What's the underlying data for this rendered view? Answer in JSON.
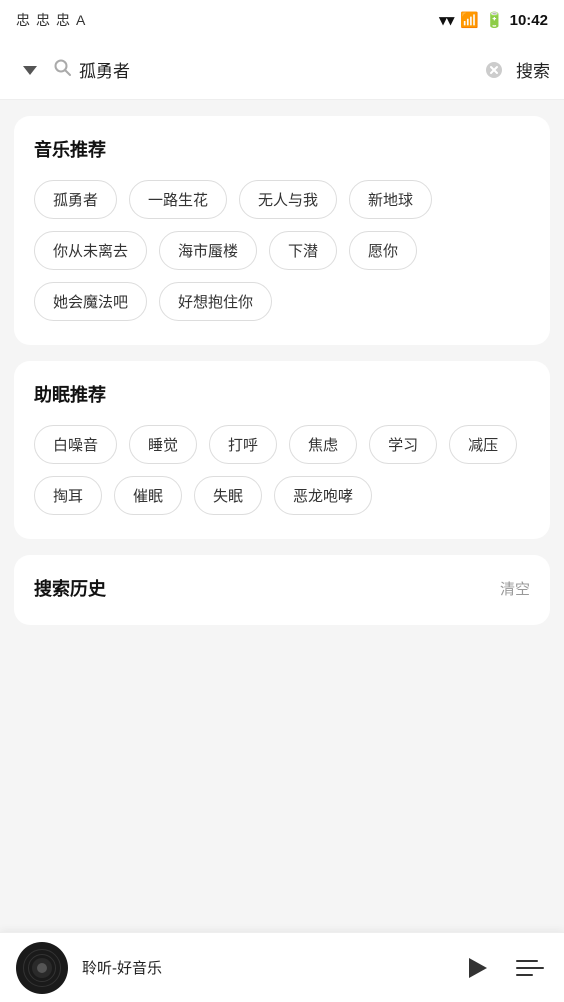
{
  "statusBar": {
    "icons": [
      "忠",
      "忠",
      "忠",
      "A"
    ],
    "time": "10:42"
  },
  "searchBar": {
    "query": "孤勇者",
    "placeholder": "搜索",
    "searchBtnLabel": "搜索"
  },
  "musicSection": {
    "title": "音乐推荐",
    "tags": [
      "孤勇者",
      "一路生花",
      "无人与我",
      "新地球",
      "你从未离去",
      "海市蜃楼",
      "下潜",
      "愿你",
      "她会魔法吧",
      "好想抱住你"
    ]
  },
  "sleepSection": {
    "title": "助眠推荐",
    "tags": [
      "白噪音",
      "睡觉",
      "打呼",
      "焦虑",
      "学习",
      "减压",
      "掏耳",
      "催眠",
      "失眠",
      "恶龙咆哮"
    ]
  },
  "historySection": {
    "title": "搜索历史",
    "clearLabel": "清空"
  },
  "player": {
    "title": "聆听-好音乐"
  }
}
